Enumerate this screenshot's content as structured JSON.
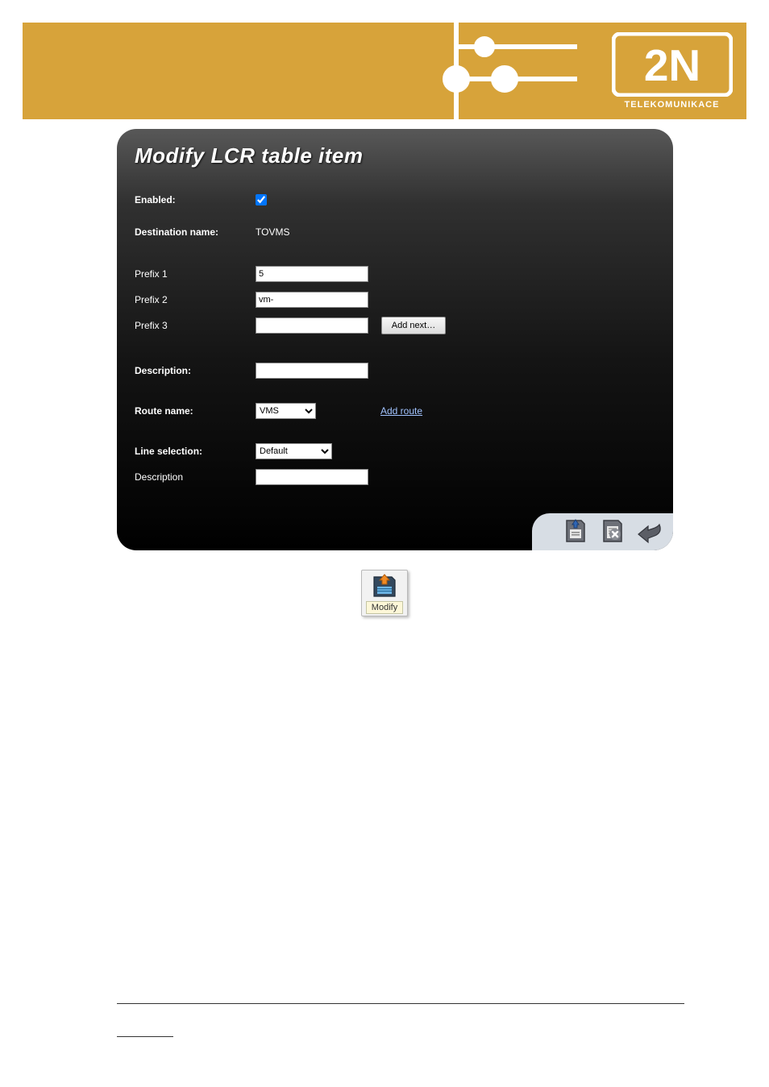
{
  "brand": {
    "logo_text": "2N",
    "tagline": "TELEKOMUNIKACE"
  },
  "panel": {
    "title": "Modify LCR table item",
    "fields": {
      "enabled_label": "Enabled:",
      "enabled": true,
      "destination_label": "Destination name:",
      "destination_value": "TOVMS",
      "prefix1_label": "Prefix 1",
      "prefix1_value": "5",
      "prefix2_label": "Prefix 2",
      "prefix2_value": "vm-",
      "prefix3_label": "Prefix 3",
      "prefix3_value": "",
      "add_next_label": "Add next…",
      "description_label": "Description:",
      "description_value": "",
      "route_label": "Route name:",
      "route_value": "VMS",
      "add_route_label": "Add route",
      "line_selection_label": "Line selection:",
      "line_selection_value": "Default",
      "desc2_label": "Description",
      "desc2_value": ""
    }
  },
  "footer_icons": {
    "save": "save-icon",
    "delete": "delete-icon",
    "back": "back-icon"
  },
  "modify_button": {
    "label": "Modify"
  }
}
